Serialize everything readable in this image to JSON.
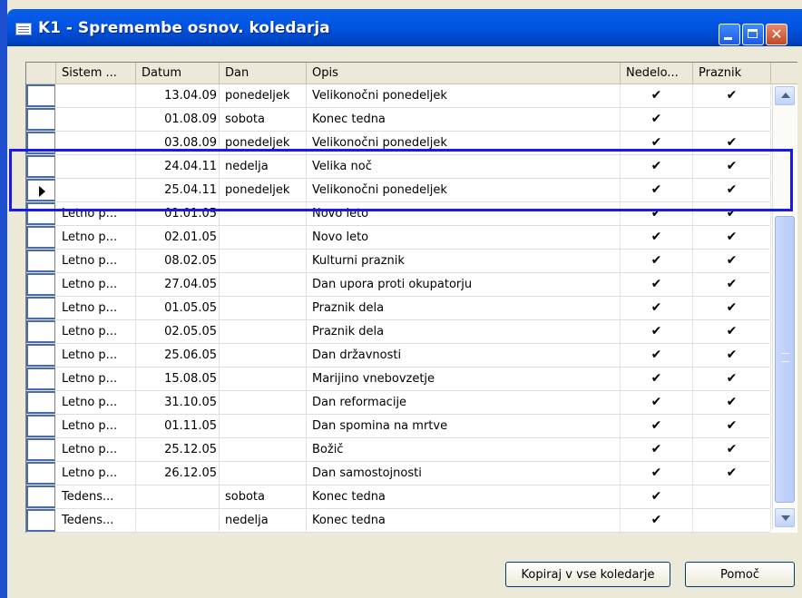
{
  "window": {
    "title": "K1 - Spremembe osnov. koledarja"
  },
  "columns": {
    "sistem": "Sistem ...",
    "datum": "Datum",
    "dan": "Dan",
    "opis": "Opis",
    "nedelo": "Nedelo...",
    "praznik": "Praznik"
  },
  "rows": [
    {
      "sistem": "",
      "datum": "13.04.09",
      "dan": "ponedeljek",
      "opis": "Velikonočni ponedeljek",
      "nedelo": "✔",
      "praznik": "✔",
      "current": false
    },
    {
      "sistem": "",
      "datum": "01.08.09",
      "dan": "sobota",
      "opis": "Konec tedna",
      "nedelo": "✔",
      "praznik": "",
      "current": false
    },
    {
      "sistem": "",
      "datum": "03.08.09",
      "dan": "ponedeljek",
      "opis": "Velikonočni ponedeljek",
      "nedelo": "✔",
      "praznik": "✔",
      "current": false
    },
    {
      "sistem": "",
      "datum": "24.04.11",
      "dan": "nedelja",
      "opis": "Velika noč",
      "nedelo": "✔",
      "praznik": "✔",
      "current": false
    },
    {
      "sistem": "",
      "datum": "25.04.11",
      "dan": "ponedeljek",
      "opis": "Velikonočni ponedeljek",
      "nedelo": "✔",
      "praznik": "✔",
      "current": true
    },
    {
      "sistem": "Letno p...",
      "datum": "01.01.05",
      "dan": "",
      "opis": "Novo leto",
      "nedelo": "✔",
      "praznik": "✔",
      "current": false
    },
    {
      "sistem": "Letno p...",
      "datum": "02.01.05",
      "dan": "",
      "opis": "Novo leto",
      "nedelo": "✔",
      "praznik": "✔",
      "current": false
    },
    {
      "sistem": "Letno p...",
      "datum": "08.02.05",
      "dan": "",
      "opis": "Kulturni praznik",
      "nedelo": "✔",
      "praznik": "✔",
      "current": false
    },
    {
      "sistem": "Letno p...",
      "datum": "27.04.05",
      "dan": "",
      "opis": "Dan upora proti okupatorju",
      "nedelo": "✔",
      "praznik": "✔",
      "current": false
    },
    {
      "sistem": "Letno p...",
      "datum": "01.05.05",
      "dan": "",
      "opis": "Praznik dela",
      "nedelo": "✔",
      "praznik": "✔",
      "current": false
    },
    {
      "sistem": "Letno p...",
      "datum": "02.05.05",
      "dan": "",
      "opis": "Praznik dela",
      "nedelo": "✔",
      "praznik": "✔",
      "current": false
    },
    {
      "sistem": "Letno p...",
      "datum": "25.06.05",
      "dan": "",
      "opis": "Dan državnosti",
      "nedelo": "✔",
      "praznik": "✔",
      "current": false
    },
    {
      "sistem": "Letno p...",
      "datum": "15.08.05",
      "dan": "",
      "opis": "Marijino vnebovzetje",
      "nedelo": "✔",
      "praznik": "✔",
      "current": false
    },
    {
      "sistem": "Letno p...",
      "datum": "31.10.05",
      "dan": "",
      "opis": "Dan reformacije",
      "nedelo": "✔",
      "praznik": "✔",
      "current": false
    },
    {
      "sistem": "Letno p...",
      "datum": "01.11.05",
      "dan": "",
      "opis": "Dan spomina na mrtve",
      "nedelo": "✔",
      "praznik": "✔",
      "current": false
    },
    {
      "sistem": "Letno p...",
      "datum": "25.12.05",
      "dan": "",
      "opis": "Božič",
      "nedelo": "✔",
      "praznik": "✔",
      "current": false
    },
    {
      "sistem": "Letno p...",
      "datum": "26.12.05",
      "dan": "",
      "opis": "Dan samostojnosti",
      "nedelo": "✔",
      "praznik": "✔",
      "current": false
    },
    {
      "sistem": "Tedens...",
      "datum": "",
      "dan": "sobota",
      "opis": "Konec tedna",
      "nedelo": "✔",
      "praznik": "",
      "current": false
    },
    {
      "sistem": "Tedens...",
      "datum": "",
      "dan": "nedelja",
      "opis": "Konec tedna",
      "nedelo": "✔",
      "praznik": "",
      "current": false
    }
  ],
  "buttons": {
    "copy": "Kopiraj v vse koledarje",
    "help": "Pomoč"
  },
  "icons": {
    "window": "table-icon",
    "minimize": "minimize-icon",
    "maximize": "maximize-icon",
    "close": "close-icon",
    "current_row": "row-pointer-icon"
  },
  "colors": {
    "titlebar": "#0054e3",
    "highlight": "#1a1ae6",
    "window_bg": "#ece9d8"
  }
}
